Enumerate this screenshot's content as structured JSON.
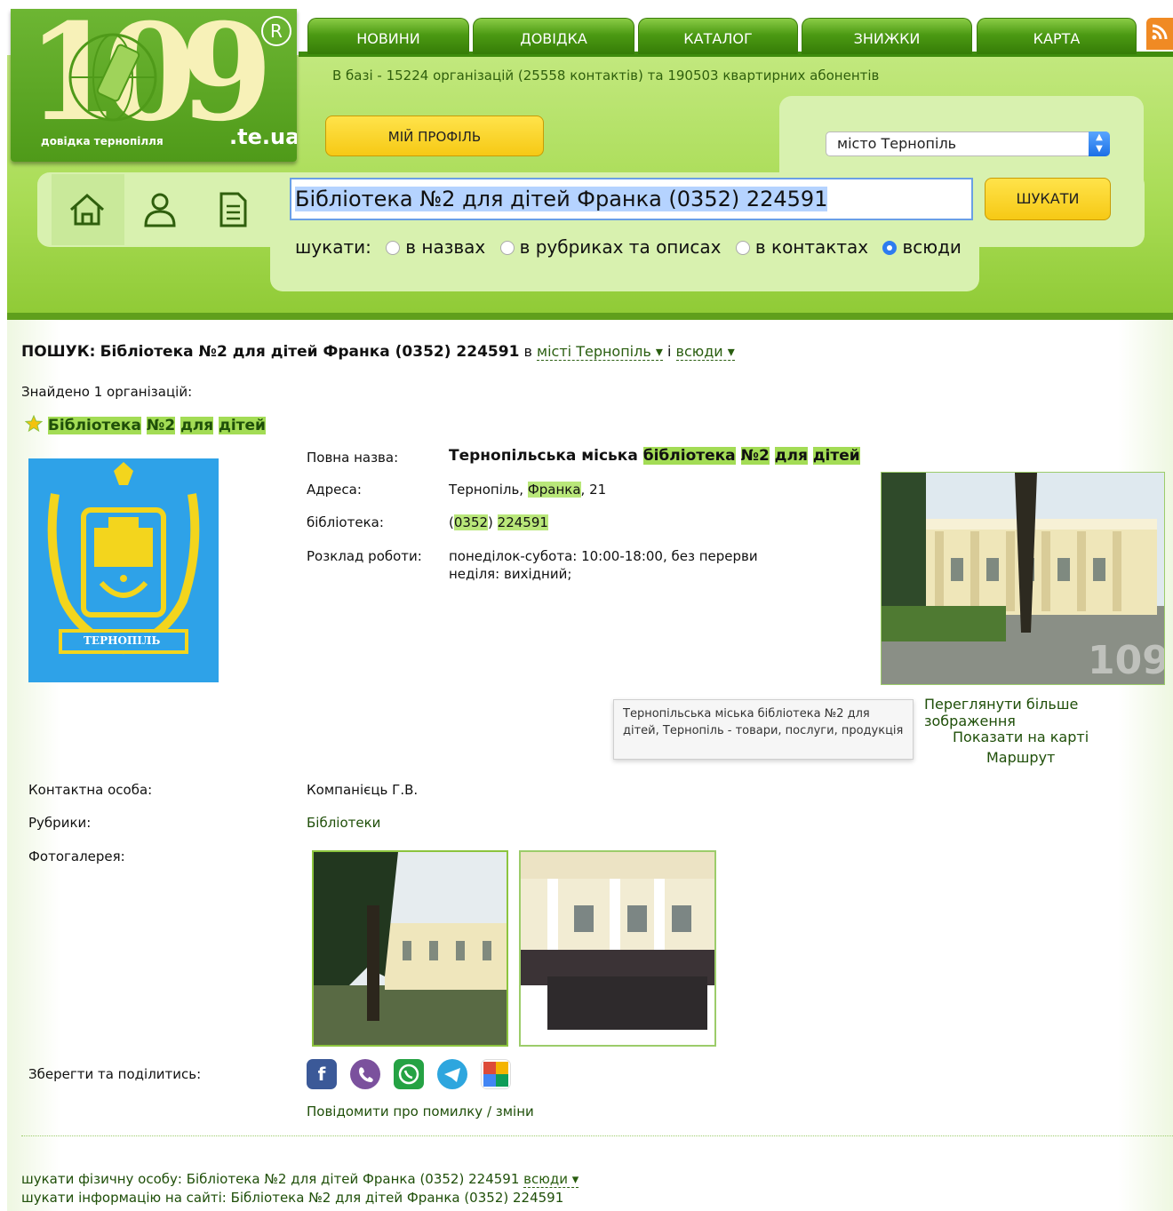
{
  "logo": {
    "number": "109",
    "registered": "R",
    "subtitle": "довідка тернопілля",
    "domain": ".te.ua"
  },
  "nav": {
    "tabs": [
      "НОВИНИ",
      "ДОВІДКА",
      "КАТАЛОГ",
      "ЗНИЖКИ",
      "КАРТА"
    ]
  },
  "header": {
    "stats": "В базі - 15224 організацій (25558 контактів) та 190503 квартирних абонентів",
    "profile_button": "МІЙ ПРОФІЛЬ",
    "city_select": "місто Тернопіль",
    "icons": [
      "home-icon",
      "person-icon",
      "document-icon",
      "rss-icon"
    ]
  },
  "search": {
    "query": "Бібліотека №2 для дітей Франка (0352) 224591",
    "button": "ШУКАТИ",
    "scope_label": "шукати:",
    "scopes": [
      "в назвах",
      "в рубриках та описах",
      "в контактах",
      "всюди"
    ],
    "selected_scope": "всюди"
  },
  "results": {
    "query_prefix": "ПОШУК:",
    "query": "Бібліотека №2 для дітей Франка (0352) 224591",
    "in_word": "в",
    "city_link": "місті Тернопіль ▾",
    "and_word": "і",
    "scope_link": "всюди ▾",
    "found": "Знайдено 1 організацій:"
  },
  "org": {
    "title_words": [
      "Бібліотека",
      "№2",
      "для",
      "дітей"
    ],
    "logo_caption": "ТЕРНОПІЛЬ",
    "full_name_label": "Повна назва:",
    "full_name_plain": "Тернопільська міська",
    "full_name_hl": [
      "бібліотека",
      "№2",
      "для",
      "дітей"
    ],
    "address_label": "Адреса:",
    "address_city": "Тернопіль,",
    "address_street": "Франка",
    "address_num": ", 21",
    "phone_label": "бібліотека:",
    "phone_code": "0352",
    "phone_number": "224591",
    "hours_label": "Розклад роботи:",
    "hours_line1": "понеділок-субота: 10:00-18:00, без перерви",
    "hours_line2": "неділя: вихідний;",
    "view_larger": "Переглянути більше зображення",
    "show_on_map": "Показати на карті",
    "route": "Маршрут",
    "tooltip": "Тернопільська міська бібліотека №2 для дітей, Тернопіль - товари, послуги, продукція",
    "contact_label": "Контактна особа:",
    "contact_value": "Компанієць Г.В.",
    "rubrics_label": "Рубрики:",
    "rubrics_value": "Бібліотеки",
    "gallery_label": "Фотогалерея:",
    "share_label": "Зберегти та поділитись:",
    "share_icons": [
      "facebook-icon",
      "viber-icon",
      "whatsapp-icon",
      "telegram-icon",
      "google-plus-icon"
    ],
    "report": "Повідомити про помилку / зміни"
  },
  "footer": {
    "line1_text": "шукати фізичну особу: Бібліотека №2 для дітей Франка (0352) 224591",
    "line1_link": "всюди ▾",
    "line2_text": "шукати інформацію на сайті: Бібліотека №2 для дітей Франка (0352) 224591"
  },
  "colors": {
    "brand_green": "#4f9a19",
    "highlight": "#a3dc55",
    "button_yellow": "#f6c915"
  }
}
